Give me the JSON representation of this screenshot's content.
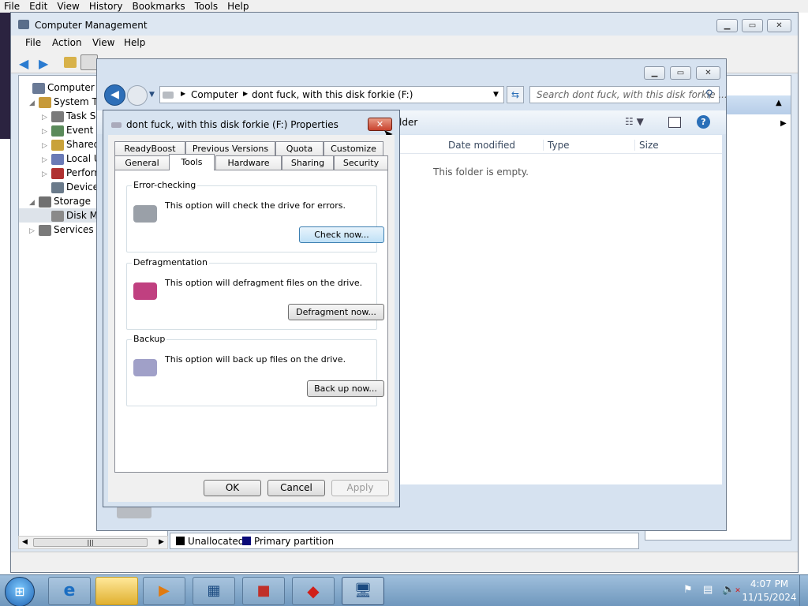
{
  "top_menubar": [
    "File",
    "Edit",
    "View",
    "History",
    "Bookmarks",
    "Tools",
    "Help"
  ],
  "cm": {
    "title": "Computer Management",
    "menu": [
      "File",
      "Action",
      "View",
      "Help"
    ],
    "tree": [
      {
        "label": "Computer Ma",
        "arrow": ""
      },
      {
        "label": "System To",
        "arrow": "◢"
      },
      {
        "label": "Task Sc",
        "arrow": "▷"
      },
      {
        "label": "Event V",
        "arrow": "▷"
      },
      {
        "label": "Shared",
        "arrow": "▷"
      },
      {
        "label": "Local U",
        "arrow": "▷"
      },
      {
        "label": "Perform",
        "arrow": "▷"
      },
      {
        "label": "Device",
        "arrow": ""
      },
      {
        "label": "Storage",
        "arrow": "◢"
      },
      {
        "label": "Disk M",
        "arrow": ""
      },
      {
        "label": "Services an",
        "arrow": "▷"
      }
    ],
    "scroll_mid": "|||",
    "legend": [
      {
        "label": "Unallocated",
        "color": "#000000"
      },
      {
        "label": "Primary partition",
        "color": "#0a0a78"
      }
    ]
  },
  "explorer": {
    "breadcrumb": [
      "Computer",
      "dont fuck, with this disk forkie (F:)"
    ],
    "search_placeholder": "Search dont fuck, with this disk forkie ...",
    "toolbar_partial": "lder",
    "columns": [
      "Date modified",
      "Type",
      "Size"
    ],
    "empty": "This folder is empty."
  },
  "props": {
    "title": "dont fuck, with this disk forkie (F:) Properties",
    "tabs_row1": [
      "ReadyBoost",
      "Previous Versions",
      "Quota",
      "Customize"
    ],
    "tabs_row2": [
      "General",
      "Tools",
      "Hardware",
      "Sharing",
      "Security"
    ],
    "groups": [
      {
        "label": "Error-checking",
        "desc": "This option will check the drive for errors.",
        "button": "Check now..."
      },
      {
        "label": "Defragmentation",
        "desc": "This option will defragment files on the drive.",
        "button": "Defragment now..."
      },
      {
        "label": "Backup",
        "desc": "This option will back up files on the drive.",
        "button": "Back up now..."
      }
    ],
    "ok": "OK",
    "cancel": "Cancel",
    "apply": "Apply"
  },
  "taskbar": {
    "time": "4:07 PM",
    "date": "11/15/2024"
  },
  "colors": {
    "accent": "#1c5fb0",
    "taskbar": "#7fa6c8",
    "close_red": "#c9422e"
  }
}
